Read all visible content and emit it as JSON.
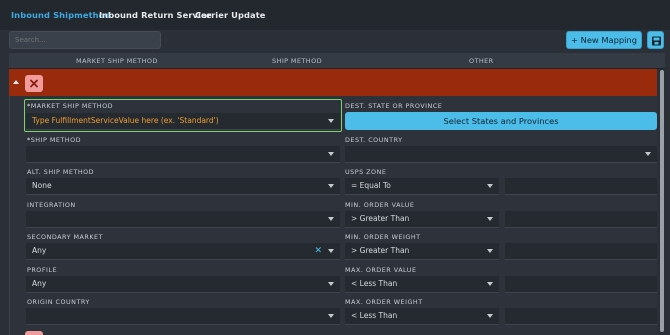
{
  "tabs": [
    {
      "label": "Inbound Shipmethod",
      "active": true
    },
    {
      "label": "Inbound Return Service",
      "active": false
    },
    {
      "label": "Carrier Update",
      "active": false
    }
  ],
  "search": {
    "placeholder": "Search..."
  },
  "toolbar": {
    "new_mapping_label": "+ New Mapping",
    "save_icon": "save-icon"
  },
  "columns": [
    "MARKET SHIP METHOD",
    "SHIP METHOD",
    "OTHER"
  ],
  "colors": {
    "accent": "#4bbde8",
    "active_tab": "#3ea9e0",
    "row_header": "#9a2a0c",
    "delete_button": "#f29b9b",
    "highlight_border": "#7fd16b",
    "placeholder_text": "#ef9d2e"
  },
  "form": {
    "left": [
      {
        "label": "MARKET SHIP METHOD",
        "required": true,
        "value": "Type FulfillmentServiceValue here (ex. 'Standard')"
      },
      {
        "label": "SHIP METHOD",
        "required": true,
        "value": ""
      },
      {
        "label": "ALT. SHIP METHOD",
        "required": false,
        "value": "None"
      },
      {
        "label": "INTEGRATION",
        "required": false,
        "value": ""
      },
      {
        "label": "SECONDARY MARKET",
        "required": false,
        "value": "Any"
      },
      {
        "label": "PROFILE",
        "required": false,
        "value": "Any"
      },
      {
        "label": "ORIGIN COUNTRY",
        "required": false,
        "value": ""
      }
    ],
    "right": [
      {
        "label": "DEST. STATE OR PROVINCE",
        "button": "Select States and Provinces"
      },
      {
        "label": "DEST. COUNTRY",
        "value": ""
      },
      {
        "label": "USPS ZONE",
        "operator": "= Equal To"
      },
      {
        "label": "MIN. ORDER VALUE",
        "operator": "> Greater Than"
      },
      {
        "label": "MIN. ORDER WEIGHT",
        "operator": "> Greater Than"
      },
      {
        "label": "MAX. ORDER VALUE",
        "operator": "< Less Than"
      },
      {
        "label": "MAX. ORDER WEIGHT",
        "operator": "< Less Than"
      }
    ],
    "required_marker": "*",
    "clear_glyph": "✕"
  }
}
